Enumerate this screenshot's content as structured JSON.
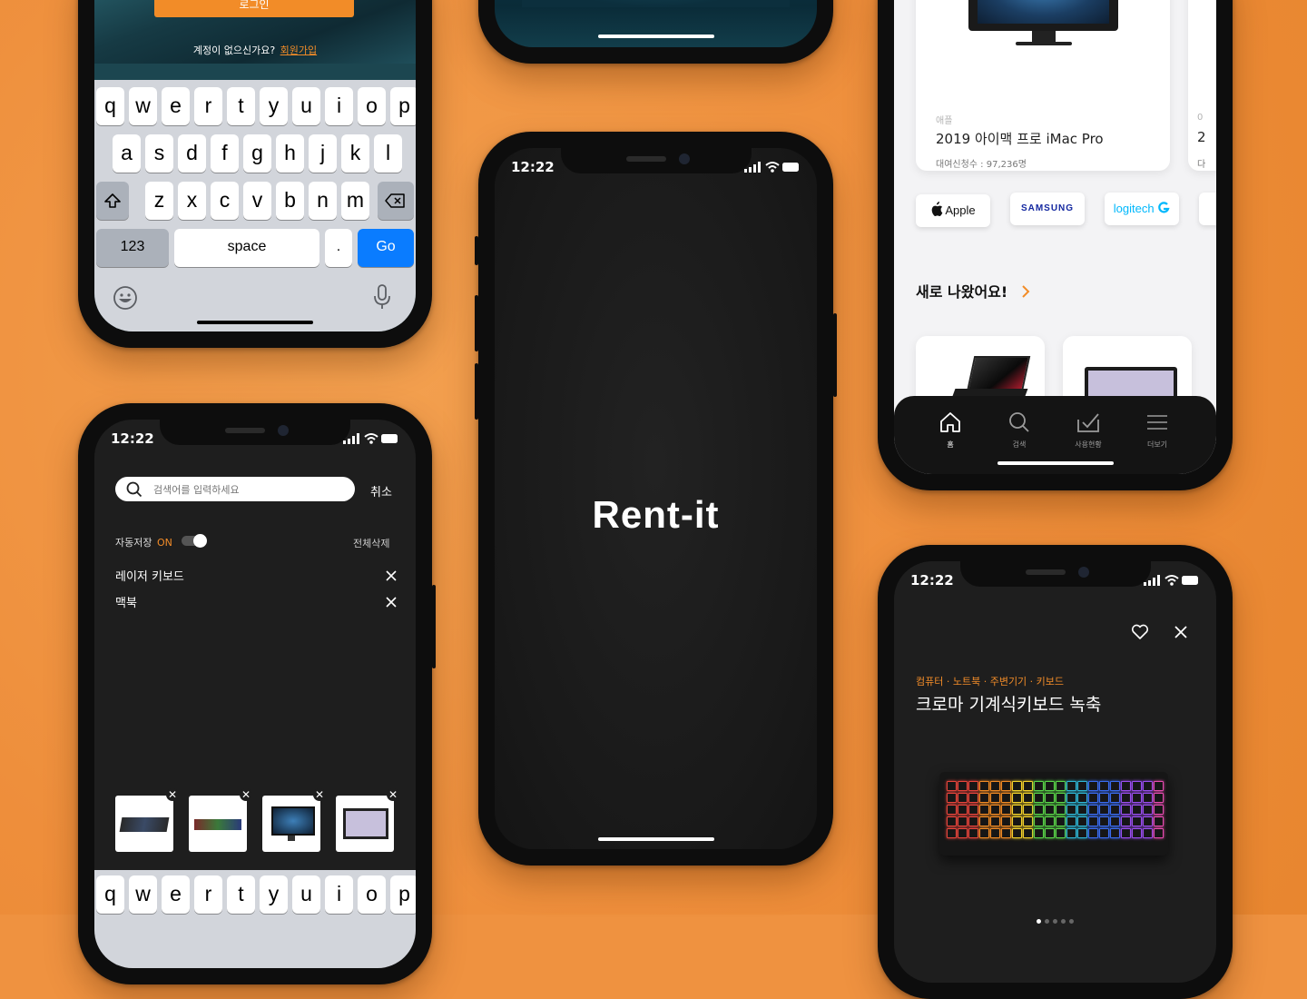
{
  "login": {
    "signup_prompt": "계정이 없으신가요?",
    "signup_link": "회원가입",
    "login_button": "로그인"
  },
  "keyboard": {
    "row1": [
      "q",
      "w",
      "e",
      "r",
      "t",
      "y",
      "u",
      "i",
      "o",
      "p"
    ],
    "row2": [
      "a",
      "s",
      "d",
      "f",
      "g",
      "h",
      "j",
      "k",
      "l"
    ],
    "row3": [
      "z",
      "x",
      "c",
      "v",
      "b",
      "n",
      "m"
    ],
    "numbers_key": "123",
    "space_key": "space",
    "period_key": ".",
    "go_key": "Go"
  },
  "status_time": "12:22",
  "splash": {
    "app_name": "Rent-it"
  },
  "home": {
    "product": {
      "brand": "애플",
      "name": "2019 아이맥 프로 iMac Pro",
      "rental_count": "대여신청수 : 97,236명"
    },
    "brands": [
      "Apple",
      "SAMSUNG",
      "logitech"
    ],
    "new_section_title": "새로 나왔어요!",
    "tabs": [
      "홈",
      "검색",
      "사용현황",
      "더보기"
    ]
  },
  "search": {
    "placeholder": "검색어를 입력하세요",
    "cancel": "취소",
    "autosave_label": "자동저장",
    "autosave_state": "ON",
    "clear_all": "전체삭제",
    "recent": [
      "레이저 키보드",
      "맥북"
    ]
  },
  "detail": {
    "breadcrumb": "컴퓨터 · 노트북 · 주변기기 · 키보드",
    "title": "크로마 기계식키보드 녹축"
  },
  "colors": {
    "accent": "#f28c28",
    "background": "#ef9240",
    "dark_screen": "#1e1e1e",
    "keyboard_blue": "#0a7cff"
  }
}
